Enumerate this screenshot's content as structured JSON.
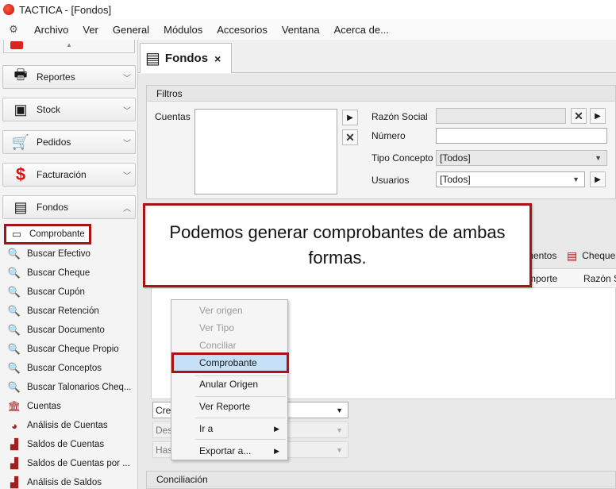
{
  "window": {
    "title": "TACTICA - [Fondos]"
  },
  "menubar": {
    "items": [
      "Archivo",
      "Ver",
      "General",
      "Módulos",
      "Accesorios",
      "Ventana",
      "Acerca de..."
    ]
  },
  "sidebar": {
    "groups": [
      {
        "label": "Reportes",
        "icon": "printer-icon"
      },
      {
        "label": "Stock",
        "icon": "box-icon"
      },
      {
        "label": "Pedidos",
        "icon": "cart-icon"
      },
      {
        "label": "Facturación",
        "icon": "dollar-icon"
      },
      {
        "label": "Fondos",
        "icon": "money-icon"
      }
    ],
    "items": [
      {
        "label": "Comprobante",
        "icon": "document-icon"
      },
      {
        "label": "Buscar Efectivo",
        "icon": "search-icon"
      },
      {
        "label": "Buscar Cheque",
        "icon": "search-icon"
      },
      {
        "label": "Buscar Cupón",
        "icon": "search-icon"
      },
      {
        "label": "Buscar Retención",
        "icon": "search-icon"
      },
      {
        "label": "Buscar Documento",
        "icon": "search-icon"
      },
      {
        "label": "Buscar Cheque Propio",
        "icon": "search-icon"
      },
      {
        "label": "Buscar Conceptos",
        "icon": "search-icon"
      },
      {
        "label": "Buscar Talonarios Cheq...",
        "icon": "search-icon"
      },
      {
        "label": "Cuentas",
        "icon": "bank-icon"
      },
      {
        "label": "Análisis de Cuentas",
        "icon": "pie-chart-icon"
      },
      {
        "label": "Saldos de Cuentas",
        "icon": "bar-chart-icon"
      },
      {
        "label": "Saldos de Cuentas por ...",
        "icon": "bar-chart-icon"
      },
      {
        "label": "Análisis de Saldos",
        "icon": "bar-chart-icon"
      }
    ]
  },
  "tab": {
    "label": "Fondos",
    "close": "×"
  },
  "filters": {
    "title": "Filtros",
    "cuentas_label": "Cuentas",
    "razon_social_label": "Razón Social",
    "numero_label": "Número",
    "tipo_concepto_label": "Tipo Concepto",
    "tipo_concepto_value": "[Todos]",
    "usuarios_label": "Usuarios",
    "usuarios_value": "[Todos]"
  },
  "grid": {
    "tabs": [
      "mentos",
      "Cheque"
    ],
    "columns": [
      "mporte",
      "Razón S"
    ]
  },
  "callout": {
    "text": "Podemos generar comprobantes de ambas formas."
  },
  "context_menu": {
    "items": [
      {
        "label": "Ver origen",
        "disabled": true
      },
      {
        "label": "Ver Tipo",
        "disabled": true
      },
      {
        "label": "Conciliar",
        "disabled": true
      },
      {
        "label": "Comprobante",
        "disabled": false
      },
      {
        "label": "Anular Origen",
        "disabled": false
      },
      {
        "label": "Ver Reporte",
        "disabled": false
      },
      {
        "label": "Ir a",
        "disabled": false,
        "submenu": true
      },
      {
        "label": "Exportar a...",
        "disabled": false,
        "submenu": true
      }
    ]
  },
  "lower": {
    "field1": "Crea",
    "field2": "Des",
    "field3": "Has"
  },
  "conciliacion": {
    "title": "Conciliación"
  },
  "colors": {
    "highlight_border": "#a81414",
    "selection": "#c6e0f7"
  }
}
